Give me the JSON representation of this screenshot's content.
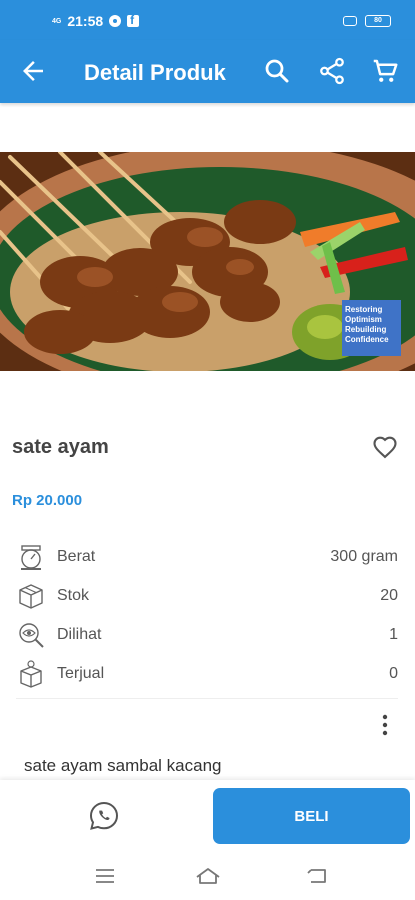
{
  "status_bar": {
    "signal_text": "4G",
    "time": "21:58",
    "battery": "80",
    "icons": [
      "signal-icon",
      "gear-icon",
      "facebook-icon",
      "network-icon",
      "battery-icon"
    ]
  },
  "app_bar": {
    "title": "Detail Produk",
    "icons": [
      "back-arrow-icon",
      "search-icon",
      "share-icon",
      "cart-icon"
    ]
  },
  "product": {
    "image_badge_lines": [
      "Restoring",
      "Optimism",
      "Rebuilding",
      "Confidence"
    ],
    "name": "sate ayam",
    "price": "Rp 20.000",
    "specs": [
      {
        "icon": "scale-icon",
        "label": "Berat",
        "value": "300 gram"
      },
      {
        "icon": "box-icon",
        "label": "Stok",
        "value": "20"
      },
      {
        "icon": "magnifier-eye-icon",
        "label": "Dilihat",
        "value": "1"
      },
      {
        "icon": "package-sold-icon",
        "label": "Terjual",
        "value": "0"
      }
    ],
    "description": "sate ayam sambal kacang"
  },
  "actions": {
    "buy_label": "BELI",
    "whatsapp_icon": "whatsapp-icon"
  },
  "colors": {
    "primary": "#2b8fdc",
    "price": "#2b8fdc"
  }
}
